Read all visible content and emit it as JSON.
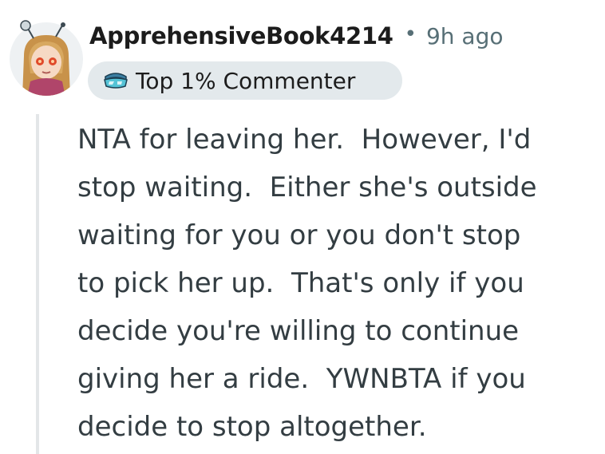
{
  "comment": {
    "author": "ApprehensiveBook4214",
    "separator": "•",
    "timestamp": "9h ago",
    "flair": {
      "icon": "top-commenter-badge-icon",
      "label": "Top 1% Commenter"
    },
    "body_lines": [
      "NTA for leaving her.  However, I'd",
      "stop waiting.  Either she's outside",
      "waiting for you or you don't stop",
      "to pick her up.  That's only if you",
      "decide you're willing to continue",
      "giving her a ride.  YWNBTA if you",
      "decide to stop altogether."
    ]
  },
  "colors": {
    "flair_background": "#e3e9ec",
    "meta_text": "#576f76",
    "body_text": "#333d42",
    "thread_line": "#e3e6e8"
  }
}
